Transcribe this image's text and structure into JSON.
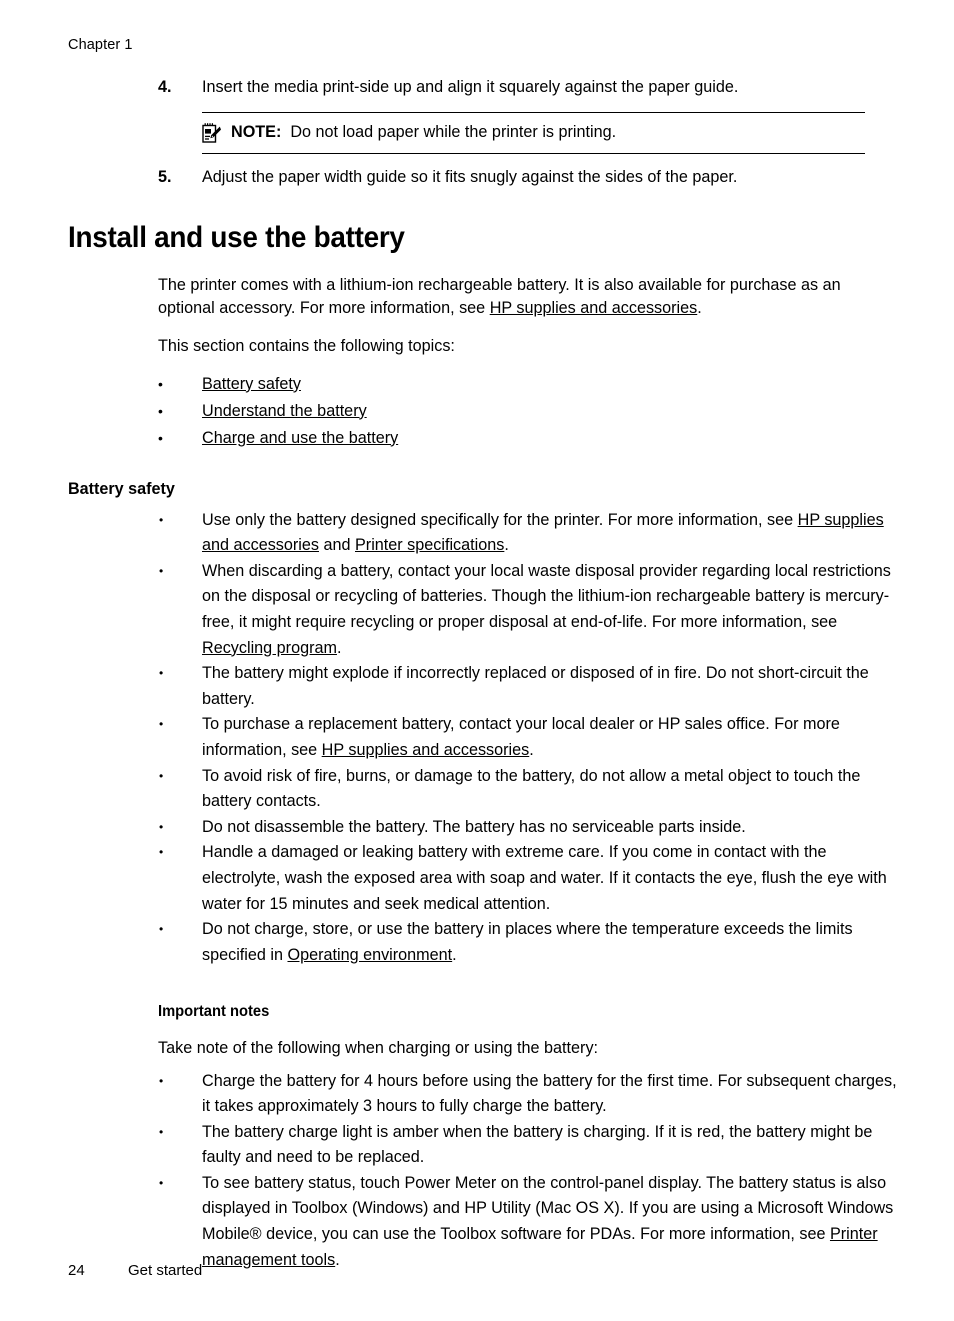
{
  "header": {
    "chapter": "Chapter 1"
  },
  "steps": [
    {
      "num": "4.",
      "text": "Insert the media print-side up and align it squarely against the paper guide."
    },
    {
      "num": "5.",
      "text": "Adjust the paper width guide so it fits snugly against the sides of the paper."
    }
  ],
  "note": {
    "icon": "note-pad-pencil-icon",
    "label": "NOTE:",
    "text": "Do not load paper while the printer is printing."
  },
  "section": {
    "title": "Install and use the battery",
    "intro_part1": "The printer comes with a lithium-ion rechargeable battery. It is also available for purchase as an optional accessory. For more information, see ",
    "intro_link": "HP supplies and accessories",
    "intro_part2": ".",
    "topics_lead": "This section contains the following topics:",
    "topics": [
      "Battery safety",
      "Understand the battery",
      "Charge and use the battery"
    ]
  },
  "battery_safety": {
    "title": "Battery safety",
    "bullets": [
      {
        "segments": [
          {
            "type": "text",
            "value": "Use only the battery designed specifically for the printer. For more information, see "
          },
          {
            "type": "link",
            "value": "HP supplies and accessories"
          },
          {
            "type": "text",
            "value": " and "
          },
          {
            "type": "link",
            "value": "Printer specifications"
          },
          {
            "type": "text",
            "value": "."
          }
        ]
      },
      {
        "segments": [
          {
            "type": "text",
            "value": "When discarding a battery, contact your local waste disposal provider regarding local restrictions on the disposal or recycling of batteries. Though the lithium-ion rechargeable battery is mercury-free, it might require recycling or proper disposal at end-of-life. For more information, see "
          },
          {
            "type": "link",
            "value": "Recycling program"
          },
          {
            "type": "text",
            "value": "."
          }
        ]
      },
      {
        "segments": [
          {
            "type": "text",
            "value": "The battery might explode if incorrectly replaced or disposed of in fire. Do not short-circuit the battery."
          }
        ]
      },
      {
        "segments": [
          {
            "type": "text",
            "value": "To purchase a replacement battery, contact your local dealer or HP sales office. For more information, see "
          },
          {
            "type": "link",
            "value": "HP supplies and accessories"
          },
          {
            "type": "text",
            "value": "."
          }
        ]
      },
      {
        "segments": [
          {
            "type": "text",
            "value": "To avoid risk of fire, burns, or damage to the battery, do not allow a metal object to touch the battery contacts."
          }
        ]
      },
      {
        "segments": [
          {
            "type": "text",
            "value": "Do not disassemble the battery. The battery has no serviceable parts inside."
          }
        ]
      },
      {
        "segments": [
          {
            "type": "text",
            "value": "Handle a damaged or leaking battery with extreme care. If you come in contact with the electrolyte, wash the exposed area with soap and water. If it contacts the eye, flush the eye with water for 15 minutes and seek medical attention."
          }
        ]
      },
      {
        "segments": [
          {
            "type": "text",
            "value": "Do not charge, store, or use the battery in places where the temperature exceeds the limits specified in "
          },
          {
            "type": "link",
            "value": "Operating environment"
          },
          {
            "type": "text",
            "value": "."
          }
        ]
      }
    ]
  },
  "important_notes": {
    "title": "Important notes",
    "lead": "Take note of the following when charging or using the battery:",
    "bullets": [
      {
        "segments": [
          {
            "type": "text",
            "value": "Charge the battery for 4 hours before using the battery for the first time. For subsequent charges, it takes approximately 3 hours to fully charge the battery."
          }
        ]
      },
      {
        "segments": [
          {
            "type": "text",
            "value": "The battery charge light is amber when the battery is charging. If it is red, the battery might be faulty and need to be replaced."
          }
        ]
      },
      {
        "segments": [
          {
            "type": "text",
            "value": "To see battery status, touch Power Meter on the control-panel display. The battery status is also displayed in Toolbox (Windows) and HP Utility (Mac OS X). If you are using a Microsoft Windows Mobile® device, you can use the Toolbox software for PDAs. For more information, see "
          },
          {
            "type": "link",
            "value": "Printer management tools"
          },
          {
            "type": "text",
            "value": "."
          }
        ]
      }
    ]
  },
  "footer": {
    "page_number": "24",
    "section_name": "Get started"
  }
}
